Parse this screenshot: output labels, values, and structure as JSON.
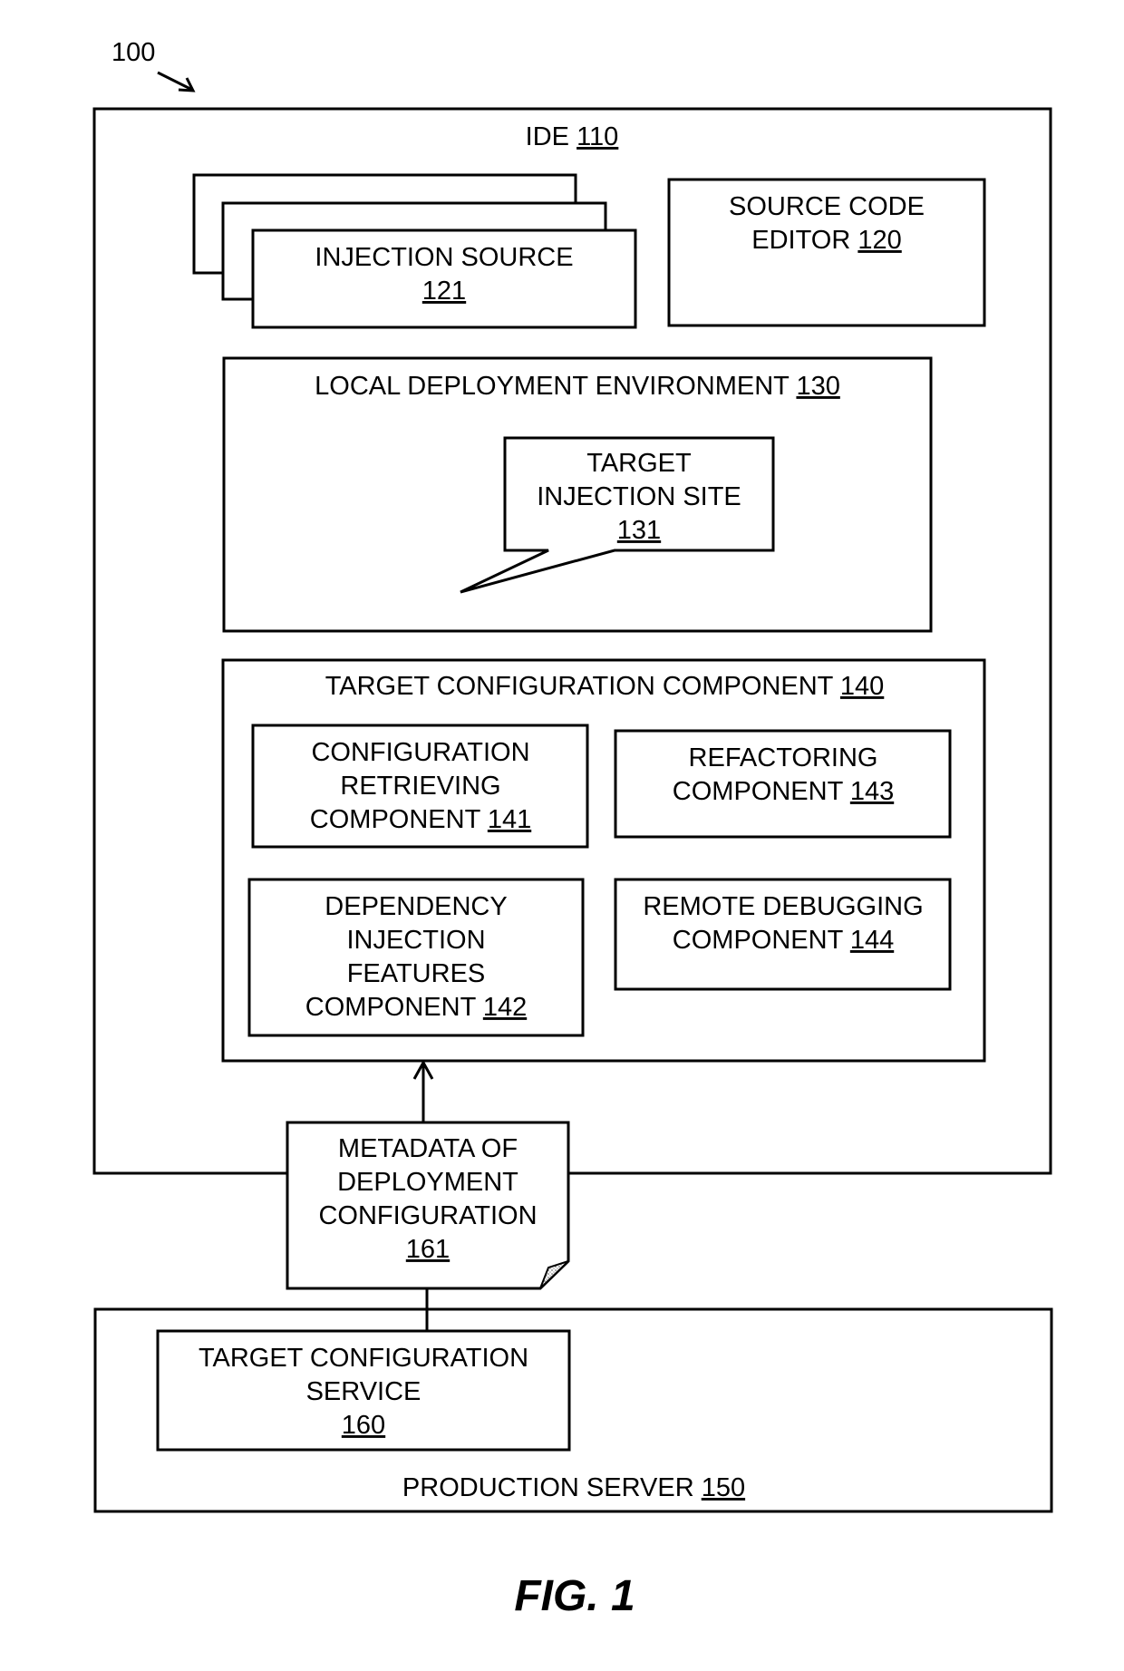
{
  "figure": {
    "ref_number": "100",
    "caption": "FIG. 1"
  },
  "ide": {
    "title": "IDE",
    "ref": "110",
    "injection_source": {
      "lines": [
        "INJECTION SOURCE"
      ],
      "ref": "121"
    },
    "source_code_editor": {
      "lines": [
        "SOURCE CODE",
        "EDITOR"
      ],
      "ref": "120"
    },
    "local_deployment_environment": {
      "title": "LOCAL DEPLOYMENT ENVIRONMENT",
      "ref": "130",
      "target_injection_site": {
        "lines": [
          "TARGET",
          "INJECTION SITE"
        ],
        "ref": "131"
      }
    },
    "target_configuration_component": {
      "title": "TARGET CONFIGURATION COMPONENT",
      "ref": "140",
      "configuration_retrieving": {
        "lines": [
          "CONFIGURATION",
          "RETRIEVING",
          "COMPONENT"
        ],
        "ref": "141"
      },
      "dependency_injection_features": {
        "lines": [
          "DEPENDENCY",
          "INJECTION",
          "FEATURES",
          "COMPONENT"
        ],
        "ref": "142"
      },
      "refactoring": {
        "lines": [
          "REFACTORING",
          "COMPONENT"
        ],
        "ref": "143"
      },
      "remote_debugging": {
        "lines": [
          "REMOTE DEBUGGING",
          "COMPONENT"
        ],
        "ref": "144"
      }
    }
  },
  "metadata_document": {
    "lines": [
      "METADATA OF",
      "DEPLOYMENT",
      "CONFIGURATION"
    ],
    "ref": "161"
  },
  "production_server": {
    "title": "PRODUCTION SERVER",
    "ref": "150",
    "target_configuration_service": {
      "lines": [
        "TARGET CONFIGURATION",
        "SERVICE"
      ],
      "ref": "160"
    }
  }
}
